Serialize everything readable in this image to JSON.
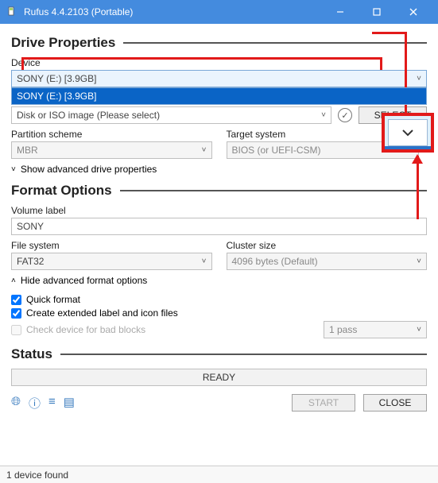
{
  "titlebar": {
    "app_icon": "rufus-icon",
    "title": "Rufus 4.4.2103 (Portable)"
  },
  "sections": {
    "drive_properties": "Drive Properties",
    "format_options": "Format Options",
    "status": "Status"
  },
  "device": {
    "label": "Device",
    "selected": "SONY (E:) [3.9GB]",
    "options": [
      "SONY (E:) [3.9GB]"
    ]
  },
  "boot_selection": {
    "value": "Disk or ISO image (Please select)",
    "select_button": "SELECT"
  },
  "partition_scheme": {
    "label": "Partition scheme",
    "value": "MBR"
  },
  "target_system": {
    "label": "Target system",
    "value": "BIOS (or UEFI-CSM)"
  },
  "adv_drive": {
    "toggle": "Show advanced drive properties"
  },
  "volume_label": {
    "label": "Volume label",
    "value": "SONY"
  },
  "file_system": {
    "label": "File system",
    "value": "FAT32"
  },
  "cluster_size": {
    "label": "Cluster size",
    "value": "4096 bytes (Default)"
  },
  "adv_format": {
    "toggle": "Hide advanced format options",
    "quick_format": "Quick format",
    "extended_label": "Create extended label and icon files",
    "bad_blocks": "Check device for bad blocks",
    "bad_blocks_passes": "1 pass"
  },
  "status_text": "READY",
  "buttons": {
    "start": "START",
    "close": "CLOSE"
  },
  "footer": {
    "device_count": "1 device found"
  },
  "bottom_icons": [
    "globe-icon",
    "info-icon",
    "settings-icon",
    "log-icon"
  ]
}
